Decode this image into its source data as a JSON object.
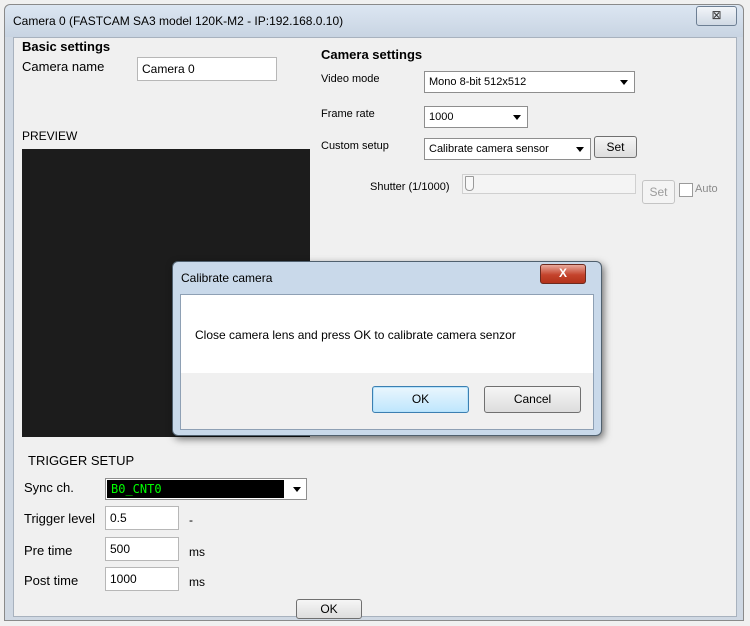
{
  "window": {
    "title": "Camera  0 (FASTCAM SA3 model 120K-M2 - IP:192.168.0.10)",
    "close_glyph": "⊠"
  },
  "basic_settings": {
    "heading": "Basic settings",
    "camera_name_label": "Camera name",
    "camera_name_value": "Camera  0",
    "preview_label": "PREVIEW"
  },
  "camera_settings": {
    "heading": "Camera settings",
    "video_mode_label": "Video mode",
    "video_mode_value": "Mono 8-bit 512x512",
    "frame_rate_label": "Frame rate",
    "frame_rate_value": "1000",
    "custom_setup_label": "Custom setup",
    "custom_setup_value": "Calibrate camera sensor",
    "set_label": "Set",
    "shutter_label": "Shutter (1/1000)",
    "shutter_set_label": "Set",
    "auto_label": "Auto"
  },
  "trigger": {
    "heading": "TRIGGER SETUP",
    "sync_label": "Sync ch.",
    "sync_value": "B0_CNT0",
    "trigger_level_label": "Trigger level",
    "trigger_level_value": "0.5",
    "trigger_level_unit": "-",
    "pre_time_label": "Pre time",
    "pre_time_value": "500",
    "pre_time_unit": "ms",
    "post_time_label": "Post time",
    "post_time_value": "1000",
    "post_time_unit": "ms"
  },
  "ok_label": "OK",
  "dialog": {
    "title": "Calibrate camera",
    "close_glyph": "X",
    "message": "Close camera lens and press OK to calibrate camera senzor",
    "ok_label": "OK",
    "cancel_label": "Cancel"
  },
  "colors": {
    "sync_bg": "#000000",
    "sync_text": "#00ff00",
    "preview_bg": "#1c1c1c"
  }
}
